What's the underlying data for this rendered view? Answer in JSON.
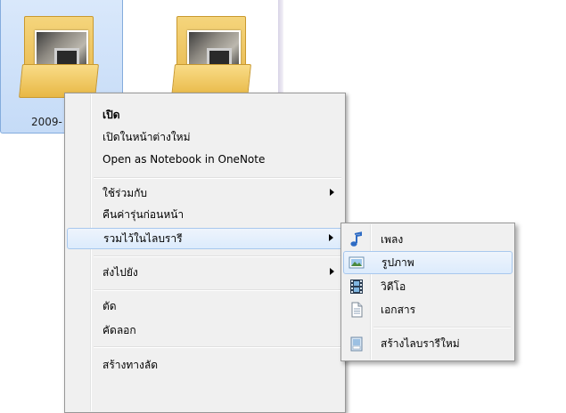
{
  "folders": [
    {
      "label": "2009-"
    },
    {
      "label": ""
    }
  ],
  "context_menu": {
    "items": [
      {
        "label": "เปิด",
        "bold": true
      },
      {
        "label": "เปิดในหน้าต่างใหม่"
      },
      {
        "label": "Open as Notebook in OneNote"
      },
      {
        "label": "ใช้ร่วมกับ",
        "has_submenu": true
      },
      {
        "label": "คืนค่ารุ่นก่อนหน้า"
      },
      {
        "label": "รวมไว้ในไลบรารี",
        "has_submenu": true,
        "highlighted": true
      },
      {
        "label": "ส่งไปยัง",
        "has_submenu": true
      },
      {
        "label": "ตัด"
      },
      {
        "label": "คัดลอก"
      },
      {
        "label": "สร้างทางลัด"
      }
    ]
  },
  "library_submenu": {
    "items": [
      {
        "label": "เพลง",
        "icon": "music-note-icon"
      },
      {
        "label": "รูปภาพ",
        "icon": "pictures-icon",
        "highlighted": true
      },
      {
        "label": "วิดีโอ",
        "icon": "film-strip-icon"
      },
      {
        "label": "เอกสาร",
        "icon": "document-icon"
      },
      {
        "label": "สร้างไลบรารีใหม่",
        "icon": "new-library-icon"
      }
    ]
  },
  "colors": {
    "menu_background": "#f0f0f0",
    "highlight_fill": "#dcebfc",
    "highlight_border": "#a8c8ee",
    "folder_selection": "#c5dbf7"
  }
}
